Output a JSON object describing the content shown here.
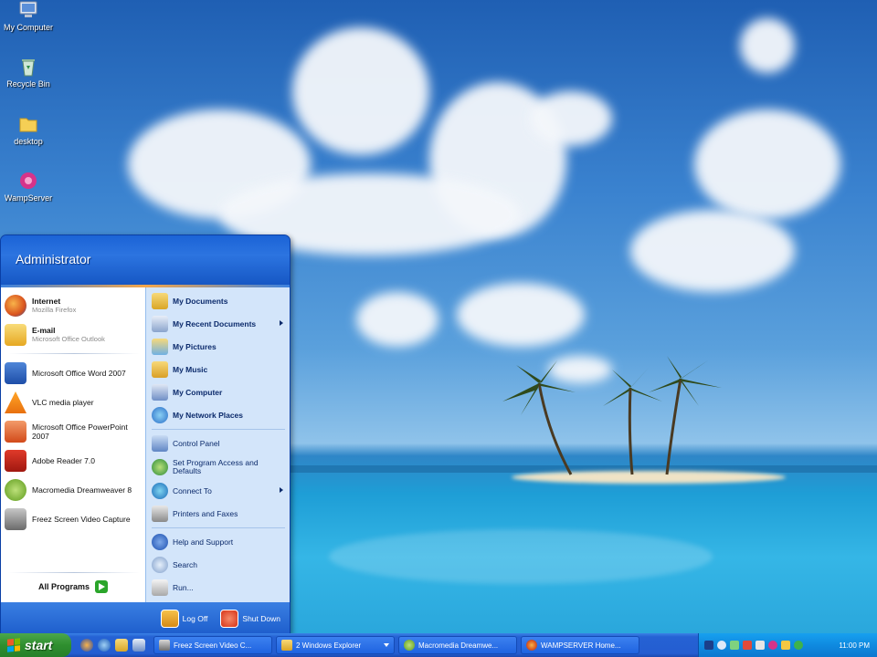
{
  "desktop": {
    "icons": [
      {
        "label": "My Computer",
        "icon": "computer-icon"
      },
      {
        "label": "Recycle Bin",
        "icon": "recycle-bin-icon"
      },
      {
        "label": "desktop",
        "icon": "folder-icon"
      },
      {
        "label": "WampServer",
        "icon": "wampserver-icon"
      }
    ]
  },
  "start_menu": {
    "user": "Administrator",
    "pinned": [
      {
        "title": "Internet",
        "subtitle": "Mozilla Firefox",
        "icon": "firefox-icon"
      },
      {
        "title": "E-mail",
        "subtitle": "Microsoft Office Outlook",
        "icon": "outlook-icon"
      }
    ],
    "recent": [
      {
        "label": "Microsoft Office Word 2007",
        "icon": "word-icon"
      },
      {
        "label": "VLC media player",
        "icon": "vlc-icon"
      },
      {
        "label": "Microsoft Office PowerPoint 2007",
        "icon": "powerpoint-icon"
      },
      {
        "label": "Adobe Reader 7.0",
        "icon": "adobe-reader-icon"
      },
      {
        "label": "Macromedia Dreamweaver 8",
        "icon": "dreamweaver-icon"
      },
      {
        "label": "Freez Screen Video Capture",
        "icon": "video-capture-icon"
      }
    ],
    "all_programs": "All Programs",
    "places": [
      {
        "label": "My Documents",
        "icon": "documents-folder-icon"
      },
      {
        "label": "My Recent Documents",
        "icon": "recent-documents-icon",
        "submenu": true
      },
      {
        "label": "My Pictures",
        "icon": "pictures-folder-icon"
      },
      {
        "label": "My Music",
        "icon": "music-folder-icon"
      },
      {
        "label": "My Computer",
        "icon": "computer-icon"
      },
      {
        "label": "My Network Places",
        "icon": "network-icon"
      }
    ],
    "system": [
      {
        "label": "Control Panel",
        "icon": "control-panel-icon"
      },
      {
        "label": "Set Program Access and Defaults",
        "icon": "program-defaults-icon"
      },
      {
        "label": "Connect To",
        "icon": "connect-icon",
        "submenu": true
      },
      {
        "label": "Printers and Faxes",
        "icon": "printer-icon"
      }
    ],
    "tools": [
      {
        "label": "Help and Support",
        "icon": "help-icon"
      },
      {
        "label": "Search",
        "icon": "search-icon"
      },
      {
        "label": "Run...",
        "icon": "run-icon"
      }
    ],
    "log_off": "Log Off",
    "shut_down": "Shut Down"
  },
  "taskbar": {
    "start_label": "start",
    "tasks": [
      {
        "label": "Freez Screen Video C...",
        "icon": "video-capture-icon"
      },
      {
        "label": "2 Windows Explorer",
        "icon": "folder-icon",
        "group": true
      },
      {
        "label": "Macromedia Dreamwe...",
        "icon": "dreamweaver-icon"
      },
      {
        "label": "WAMPSERVER Home...",
        "icon": "firefox-icon"
      }
    ],
    "clock": "11:00 PM"
  },
  "colors": {
    "taskbar_blue": "#245dd1",
    "start_green": "#2f8f2f",
    "menu_header": "#1b63d6",
    "right_pane": "#d3e5fa",
    "tray_blue": "#0f8ae0"
  }
}
